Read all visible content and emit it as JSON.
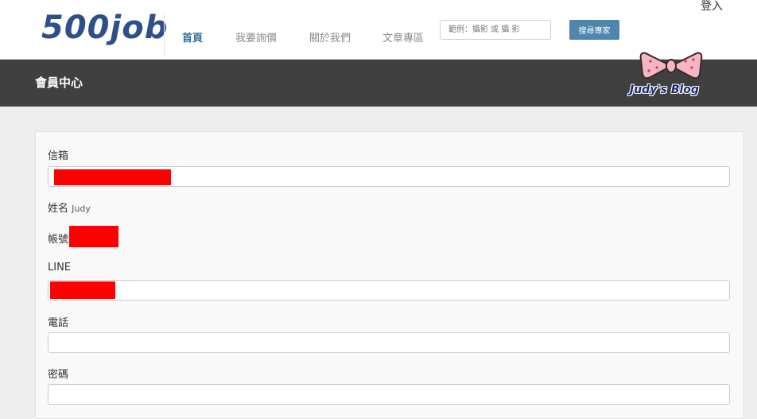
{
  "header": {
    "logo": "500job",
    "nav": [
      "首頁",
      "我要詢價",
      "關於我們",
      "文章專區"
    ],
    "search_placeholder": "範例：攝影 或 攝 影",
    "search_button": "搜尋專家",
    "login": "登入"
  },
  "titlebar": {
    "title": "會員中心",
    "watermark": "Judy's Blog"
  },
  "form": {
    "email_label": "信箱",
    "name_label": "姓名",
    "name_value": "Judy",
    "account_label": "帳號",
    "line_label": "LINE",
    "phone_label": "電話",
    "password_label": "密碼"
  },
  "colors": {
    "redaction": "#ff0000",
    "titlebar": "#404040",
    "accent": "#4f86ad"
  }
}
